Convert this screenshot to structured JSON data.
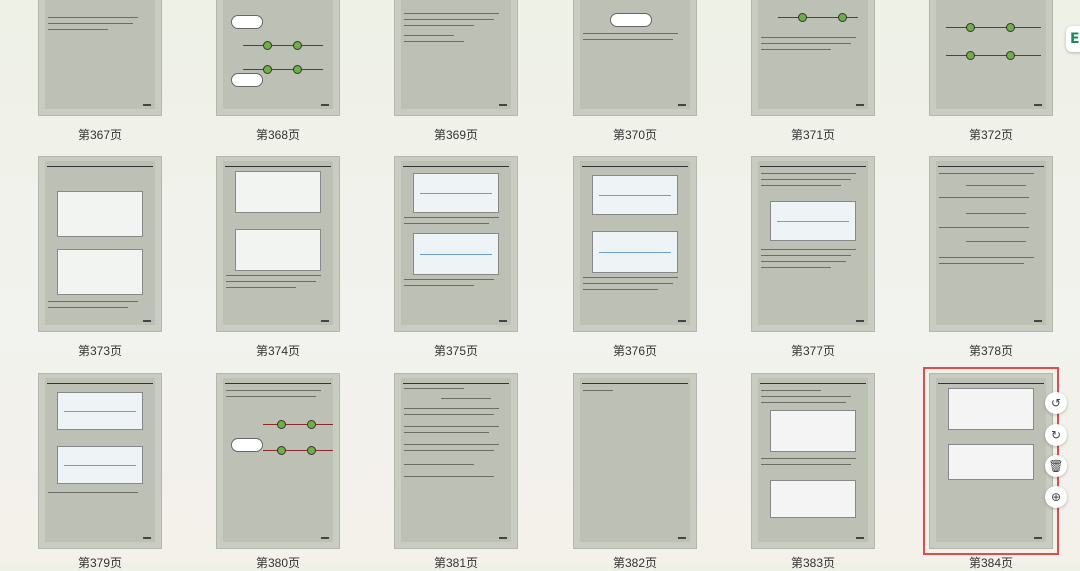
{
  "pages": [
    {
      "label": "第367页",
      "kind": "text"
    },
    {
      "label": "第368页",
      "kind": "diagram"
    },
    {
      "label": "第369页",
      "kind": "text"
    },
    {
      "label": "第370页",
      "kind": "text"
    },
    {
      "label": "第371页",
      "kind": "diagram"
    },
    {
      "label": "第372页",
      "kind": "diagram"
    },
    {
      "label": "第373页",
      "kind": "circuit"
    },
    {
      "label": "第374页",
      "kind": "circuit"
    },
    {
      "label": "第375页",
      "kind": "chart"
    },
    {
      "label": "第376页",
      "kind": "chart"
    },
    {
      "label": "第377页",
      "kind": "chart"
    },
    {
      "label": "第378页",
      "kind": "text"
    },
    {
      "label": "第379页",
      "kind": "chart"
    },
    {
      "label": "第380页",
      "kind": "diagram"
    },
    {
      "label": "第381页",
      "kind": "text"
    },
    {
      "label": "第382页",
      "kind": "blank"
    },
    {
      "label": "第383页",
      "kind": "table"
    },
    {
      "label": "第384页",
      "kind": "table"
    }
  ],
  "selected_page": "第384页",
  "toolbar": {
    "rotate_left_icon": "rotate-left-icon",
    "rotate_right_icon": "rotate-right-icon",
    "delete_icon": "trash-icon",
    "add_icon": "plus-circle-icon"
  },
  "accent": "#e14b4b"
}
